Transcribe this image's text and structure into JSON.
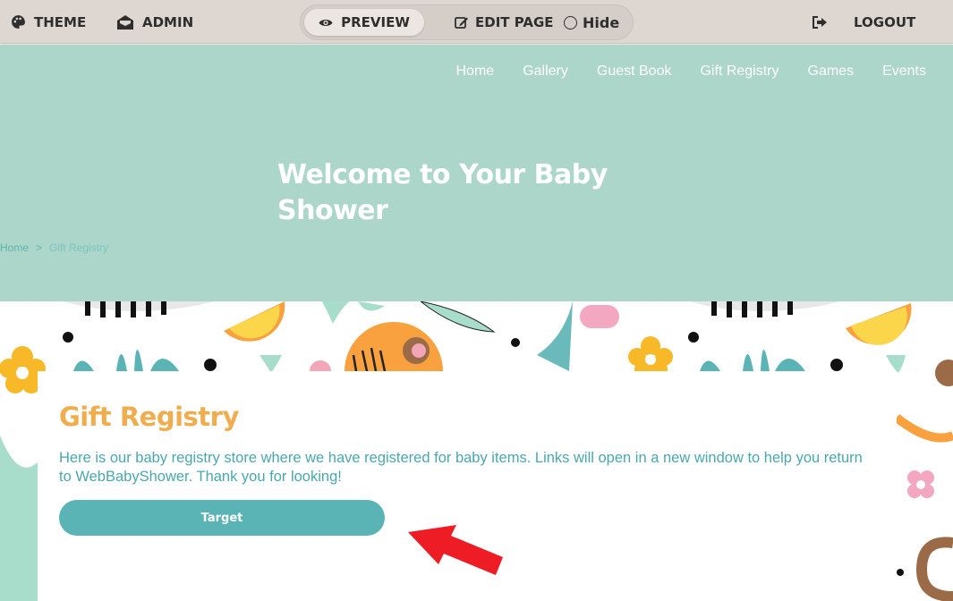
{
  "toolbar": {
    "theme_label": "THEME",
    "admin_label": "ADMIN",
    "preview_label": "PREVIEW",
    "edit_label": "EDIT PAGE",
    "hide_label": "Hide",
    "logout_label": "LOGOUT",
    "icons": [
      "palette-icon",
      "envelope-open-icon",
      "eye-icon",
      "edit-icon",
      "radio-icon",
      "sign-out-icon"
    ]
  },
  "nav": {
    "items": [
      "Home",
      "Gallery",
      "Guest Book",
      "Gift Registry",
      "Games",
      "Events"
    ]
  },
  "hero": {
    "title": "Welcome to Your Baby Shower",
    "background": "#abd6c9"
  },
  "breadcrumb": {
    "home": "Home",
    "separator": ">",
    "current": "Gift Registry"
  },
  "content": {
    "title": "Gift Registry",
    "text": "Here is our baby registry store where we have registered for baby items. Links will open in a new window to help you return to WebBabyShower. Thank you for looking!",
    "button_label": "Target"
  },
  "colors": {
    "accent_orange": "#f0ad4e",
    "teal": "#5ab3b5",
    "annotation_arrow": "#ee1c25"
  }
}
